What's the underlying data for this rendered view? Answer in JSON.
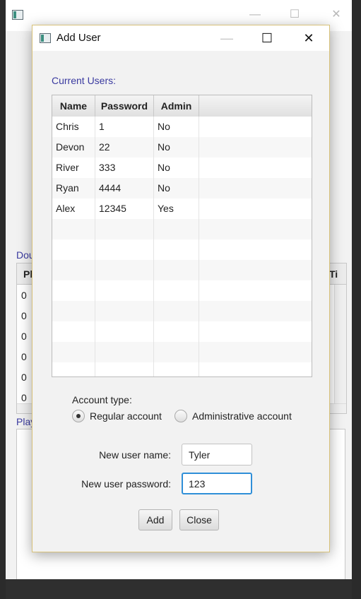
{
  "background_window": {
    "label_partial_1": "Dou",
    "table_header_left": "Pl",
    "table_header_right": "Ti",
    "cell_values": [
      "0",
      "0",
      "0",
      "0",
      "0",
      "0"
    ],
    "label_partial_2": "Play"
  },
  "dialog": {
    "title": "Add User",
    "current_users_label": "Current Users:",
    "table": {
      "columns": [
        "Name",
        "Password",
        "Admin"
      ],
      "rows": [
        {
          "name": "Chris",
          "password": "1",
          "admin": "No"
        },
        {
          "name": "Devon",
          "password": "22",
          "admin": "No"
        },
        {
          "name": "River",
          "password": "333",
          "admin": "No"
        },
        {
          "name": "Ryan",
          "password": "4444",
          "admin": "No"
        },
        {
          "name": "Alex",
          "password": "12345",
          "admin": "Yes"
        }
      ]
    },
    "account_type": {
      "label": "Account type:",
      "options": [
        "Regular account",
        "Administrative account"
      ],
      "selected": "Regular account"
    },
    "form": {
      "username_label": "New user name:",
      "username_value": "Tyler",
      "password_label": "New user password:",
      "password_value": "123"
    },
    "buttons": {
      "add": "Add",
      "close": "Close"
    }
  }
}
